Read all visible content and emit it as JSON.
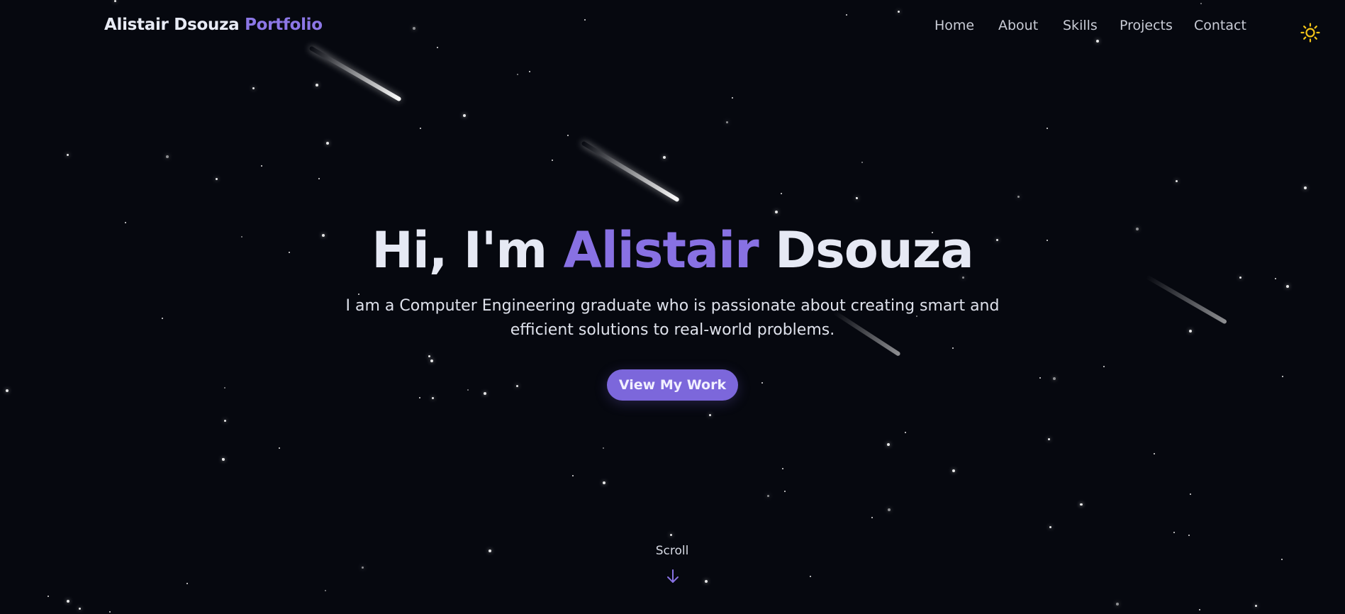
{
  "navbar": {
    "brand_name": "Alistair Dsouza",
    "brand_suffix": "Portfolio",
    "links": [
      "Home",
      "About",
      "Skills",
      "Projects",
      "Contact"
    ],
    "theme_toggle_icon": "sun-icon"
  },
  "hero": {
    "greeting": "Hi, I'm",
    "first_name": "Alistair",
    "last_name": "Dsouza",
    "description": "I am a Computer Engineering graduate who is passionate about creating smart and efficient solutions to real-world problems.",
    "cta_label": "View My Work"
  },
  "scroll_indicator": {
    "label": "Scroll",
    "icon": "arrow-down-icon"
  },
  "colors": {
    "background": "#06080f",
    "accent": "#8871e3",
    "button": "#7c67db",
    "sun": "#f5c518",
    "text": "#e6e9f4"
  }
}
